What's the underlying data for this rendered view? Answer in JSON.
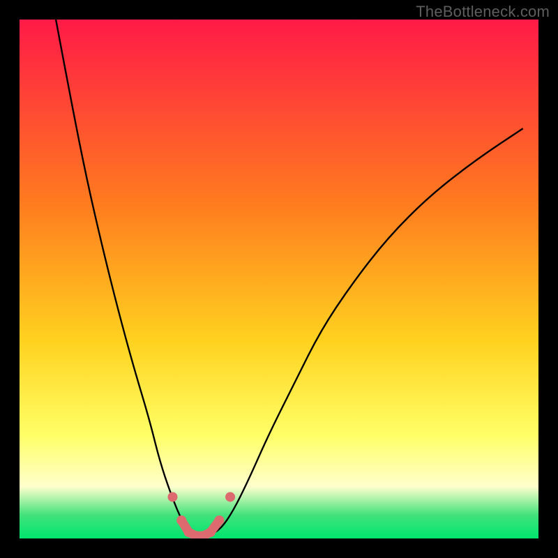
{
  "watermark": {
    "text": "TheBottleneck.com"
  },
  "colors": {
    "page_bg": "#000000",
    "watermark": "#5e5e5e",
    "curve_stroke": "#000000",
    "marker_fill": "#dd6a6e",
    "grad_top": "#ff1a47",
    "grad_upper_mid": "#ff7a1f",
    "grad_mid": "#ffd21f",
    "grad_lower_mid": "#ffff66",
    "grad_pale_band": "#ffffcc",
    "grad_green_top": "#41e27b",
    "grad_green_bottom": "#00e56e"
  },
  "chart_data": {
    "type": "line",
    "title": "",
    "xlabel": "",
    "ylabel": "",
    "xlim": [
      0,
      100
    ],
    "ylim": [
      0,
      100
    ],
    "series": [
      {
        "name": "bottleneck-curve",
        "x": [
          7,
          10,
          13,
          16,
          19,
          22,
          25,
          27,
          29,
          31,
          32.5,
          34,
          36,
          38.5,
          41,
          44,
          48,
          53,
          58,
          64,
          71,
          79,
          88,
          97
        ],
        "values": [
          100,
          84,
          69,
          56,
          44,
          33,
          23,
          15,
          9,
          4,
          1.5,
          0.5,
          0.5,
          1.5,
          5,
          11,
          20,
          30,
          40,
          49,
          58,
          66,
          73,
          79
        ]
      }
    ],
    "markers": {
      "name": "highlight-points",
      "x": [
        29.5,
        31.2,
        32.6,
        34.0,
        35.4,
        36.8,
        38.5,
        40.6
      ],
      "values": [
        8.0,
        3.5,
        1.2,
        0.5,
        0.5,
        1.2,
        3.5,
        8.0
      ],
      "between_x": [
        31.2,
        38.5
      ]
    },
    "background_gradient": {
      "stops": [
        {
          "offset": 0.0,
          "color_key": "grad_top"
        },
        {
          "offset": 0.35,
          "color_key": "grad_upper_mid"
        },
        {
          "offset": 0.62,
          "color_key": "grad_mid"
        },
        {
          "offset": 0.8,
          "color_key": "grad_lower_mid"
        },
        {
          "offset": 0.9,
          "color_key": "grad_pale_band"
        },
        {
          "offset": 0.955,
          "color_key": "grad_green_top"
        },
        {
          "offset": 1.0,
          "color_key": "grad_green_bottom"
        }
      ]
    }
  }
}
